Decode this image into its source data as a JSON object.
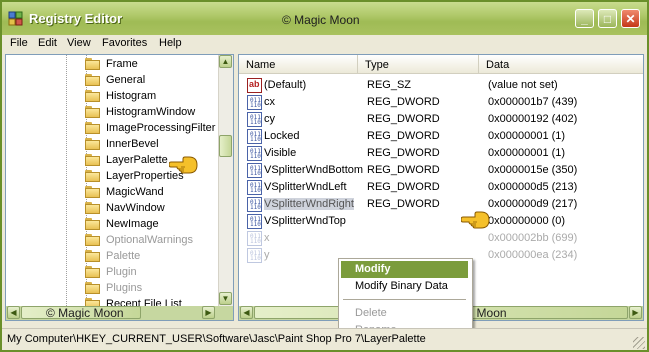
{
  "window": {
    "title": "Registry Editor",
    "watermark": "© Magic Moon"
  },
  "title_buttons": {
    "minimize": "_",
    "maximize": "□",
    "close": "✕"
  },
  "menu": [
    "File",
    "Edit",
    "View",
    "Favorites",
    "Help"
  ],
  "tree": {
    "items": [
      {
        "label": "Frame",
        "greyed": false
      },
      {
        "label": "General",
        "greyed": false
      },
      {
        "label": "Histogram",
        "greyed": false
      },
      {
        "label": "HistogramWindow",
        "greyed": false
      },
      {
        "label": "ImageProcessingFilter",
        "greyed": false
      },
      {
        "label": "InnerBevel",
        "greyed": false
      },
      {
        "label": "LayerPalette",
        "greyed": false
      },
      {
        "label": "LayerProperties",
        "greyed": false
      },
      {
        "label": "MagicWand",
        "greyed": false
      },
      {
        "label": "NavWindow",
        "greyed": false
      },
      {
        "label": "NewImage",
        "greyed": false
      },
      {
        "label": "OptionalWarnings",
        "greyed": true
      },
      {
        "label": "Palette",
        "greyed": true
      },
      {
        "label": "Plugin",
        "greyed": true
      },
      {
        "label": "Plugins",
        "greyed": true
      },
      {
        "label": "Recent File List",
        "greyed": false
      }
    ],
    "scroll_watermark": "© Magic Moon"
  },
  "list": {
    "columns": [
      "Name",
      "Type",
      "Data"
    ],
    "rows": [
      {
        "icon": "string-value-icon",
        "name": "(Default)",
        "type": "REG_SZ",
        "data": "(value not set)",
        "faded": false
      },
      {
        "icon": "dword-value-icon",
        "name": "cx",
        "type": "REG_DWORD",
        "data": "0x000001b7 (439)",
        "faded": false
      },
      {
        "icon": "dword-value-icon",
        "name": "cy",
        "type": "REG_DWORD",
        "data": "0x00000192 (402)",
        "faded": false
      },
      {
        "icon": "dword-value-icon",
        "name": "Locked",
        "type": "REG_DWORD",
        "data": "0x00000001 (1)",
        "faded": false
      },
      {
        "icon": "dword-value-icon",
        "name": "Visible",
        "type": "REG_DWORD",
        "data": "0x00000001 (1)",
        "faded": false
      },
      {
        "icon": "dword-value-icon",
        "name": "VSplitterWndBottom",
        "type": "REG_DWORD",
        "data": "0x0000015e (350)",
        "faded": false
      },
      {
        "icon": "dword-value-icon",
        "name": "VSplitterWndLeft",
        "type": "REG_DWORD",
        "data": "0x000000d5 (213)",
        "faded": false
      },
      {
        "icon": "dword-value-icon",
        "name": "VSplitterWndRight",
        "type": "REG_DWORD",
        "data": "0x000000d9 (217)",
        "faded": false
      },
      {
        "icon": "dword-value-icon",
        "name": "VSplitterWndTop",
        "type": "",
        "data": "0x00000000 (0)",
        "faded": false
      },
      {
        "icon": "dword-value-icon",
        "name": "x",
        "type": "",
        "data": "0x000002bb (699)",
        "faded": true
      },
      {
        "icon": "dword-value-icon",
        "name": "y",
        "type": "",
        "data": "0x000000ea (234)",
        "faded": true
      }
    ],
    "scroll_watermark": "© Magic Moon"
  },
  "context_menu": {
    "items": [
      {
        "label": "Modify",
        "state": "active"
      },
      {
        "label": "Modify Binary Data",
        "state": "normal"
      },
      {
        "label": "Delete",
        "state": "disabled"
      },
      {
        "label": "Rename",
        "state": "disabled"
      }
    ]
  },
  "status": {
    "path": "My Computer\\HKEY_CURRENT_USER\\Software\\Jasc\\Paint Shop Pro 7\\LayerPalette"
  },
  "colors": {
    "titlebar": "#a9c25f",
    "menu_highlight": "#7b9c3c",
    "border": "#6a8f2a"
  }
}
